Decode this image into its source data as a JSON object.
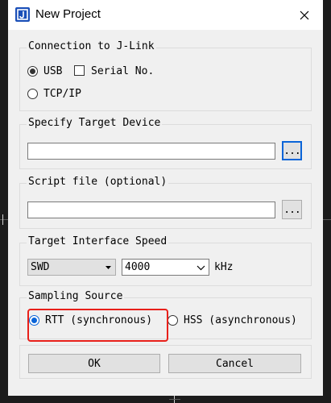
{
  "window": {
    "title": "New Project"
  },
  "connection": {
    "label": "Connection to J-Link",
    "usb_label": "USB",
    "serial_label": "Serial No.",
    "tcpip_label": "TCP/IP"
  },
  "target_device": {
    "label": "Specify Target Device",
    "value": "",
    "browse_label": "..."
  },
  "script_file": {
    "label": "Script file (optional)",
    "value": "",
    "browse_label": "..."
  },
  "interface": {
    "label": "Target Interface  Speed",
    "interface_value": "SWD",
    "speed_value": "4000",
    "speed_unit": "kHz"
  },
  "sampling": {
    "label": "Sampling Source",
    "rtt_label": "RTT (synchronous)",
    "hss_label": "HSS (asynchronous)"
  },
  "buttons": {
    "ok_label": "OK",
    "cancel_label": "Cancel"
  },
  "colors": {
    "accent": "#0a64d8",
    "highlight": "#e8201a",
    "dialog_bg": "#f0f0f0"
  }
}
